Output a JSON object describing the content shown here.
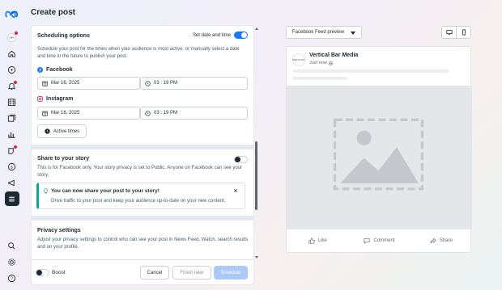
{
  "page": {
    "title": "Create post"
  },
  "scheduling": {
    "title": "Scheduling options",
    "toggle_label": "Set date and time",
    "description": "Schedule your post for the times when your audience is most active, or manually select a date and time in the future to publish your post.",
    "facebook": {
      "label": "Facebook",
      "date": "Mar 16, 2025",
      "time": "03 : 19 PM"
    },
    "instagram": {
      "label": "Instagram",
      "date": "Mar 16, 2025",
      "time": "03 : 19 PM"
    },
    "active_times_label": "Active times"
  },
  "story": {
    "title": "Share to your story",
    "description": "This is for Facebook only. Your story privacy is set to Public. Anyone on Facebook can see your story.",
    "notice_title": "You can now share your post to your story!",
    "notice_body": "Drive traffic to your post and keep your audience up-to-date on your new content."
  },
  "privacy": {
    "title": "Privacy settings",
    "description": "Adjust your privacy settings to control who can see your post in News Feed, Watch, search results and on your profile."
  },
  "footer": {
    "boost_label": "Boost",
    "cancel_label": "Cancel",
    "finish_later_label": "Finish later",
    "schedule_label": "Schedule"
  },
  "preview": {
    "dropdown_label": "Facebook Feed preview",
    "page_name": "Vertical Bar Media",
    "post_time": "Just now",
    "avatar_text": "VERTICAL",
    "like_label": "Like",
    "comment_label": "Comment",
    "share_label": "Share"
  },
  "colors": {
    "accent": "#1877f2",
    "notice_accent": "#1aa18a",
    "badge": "#e41e3f"
  },
  "icons": {
    "rail": [
      "meta-logo",
      "profile-avatar-icon",
      "home-icon",
      "compass-icon",
      "bell-icon",
      "calendar-icon",
      "content-icon",
      "insights-icon",
      "ads-icon",
      "monetization-icon",
      "megaphone-icon",
      "menu-icon",
      "search-icon",
      "settings-icon",
      "help-icon"
    ]
  }
}
